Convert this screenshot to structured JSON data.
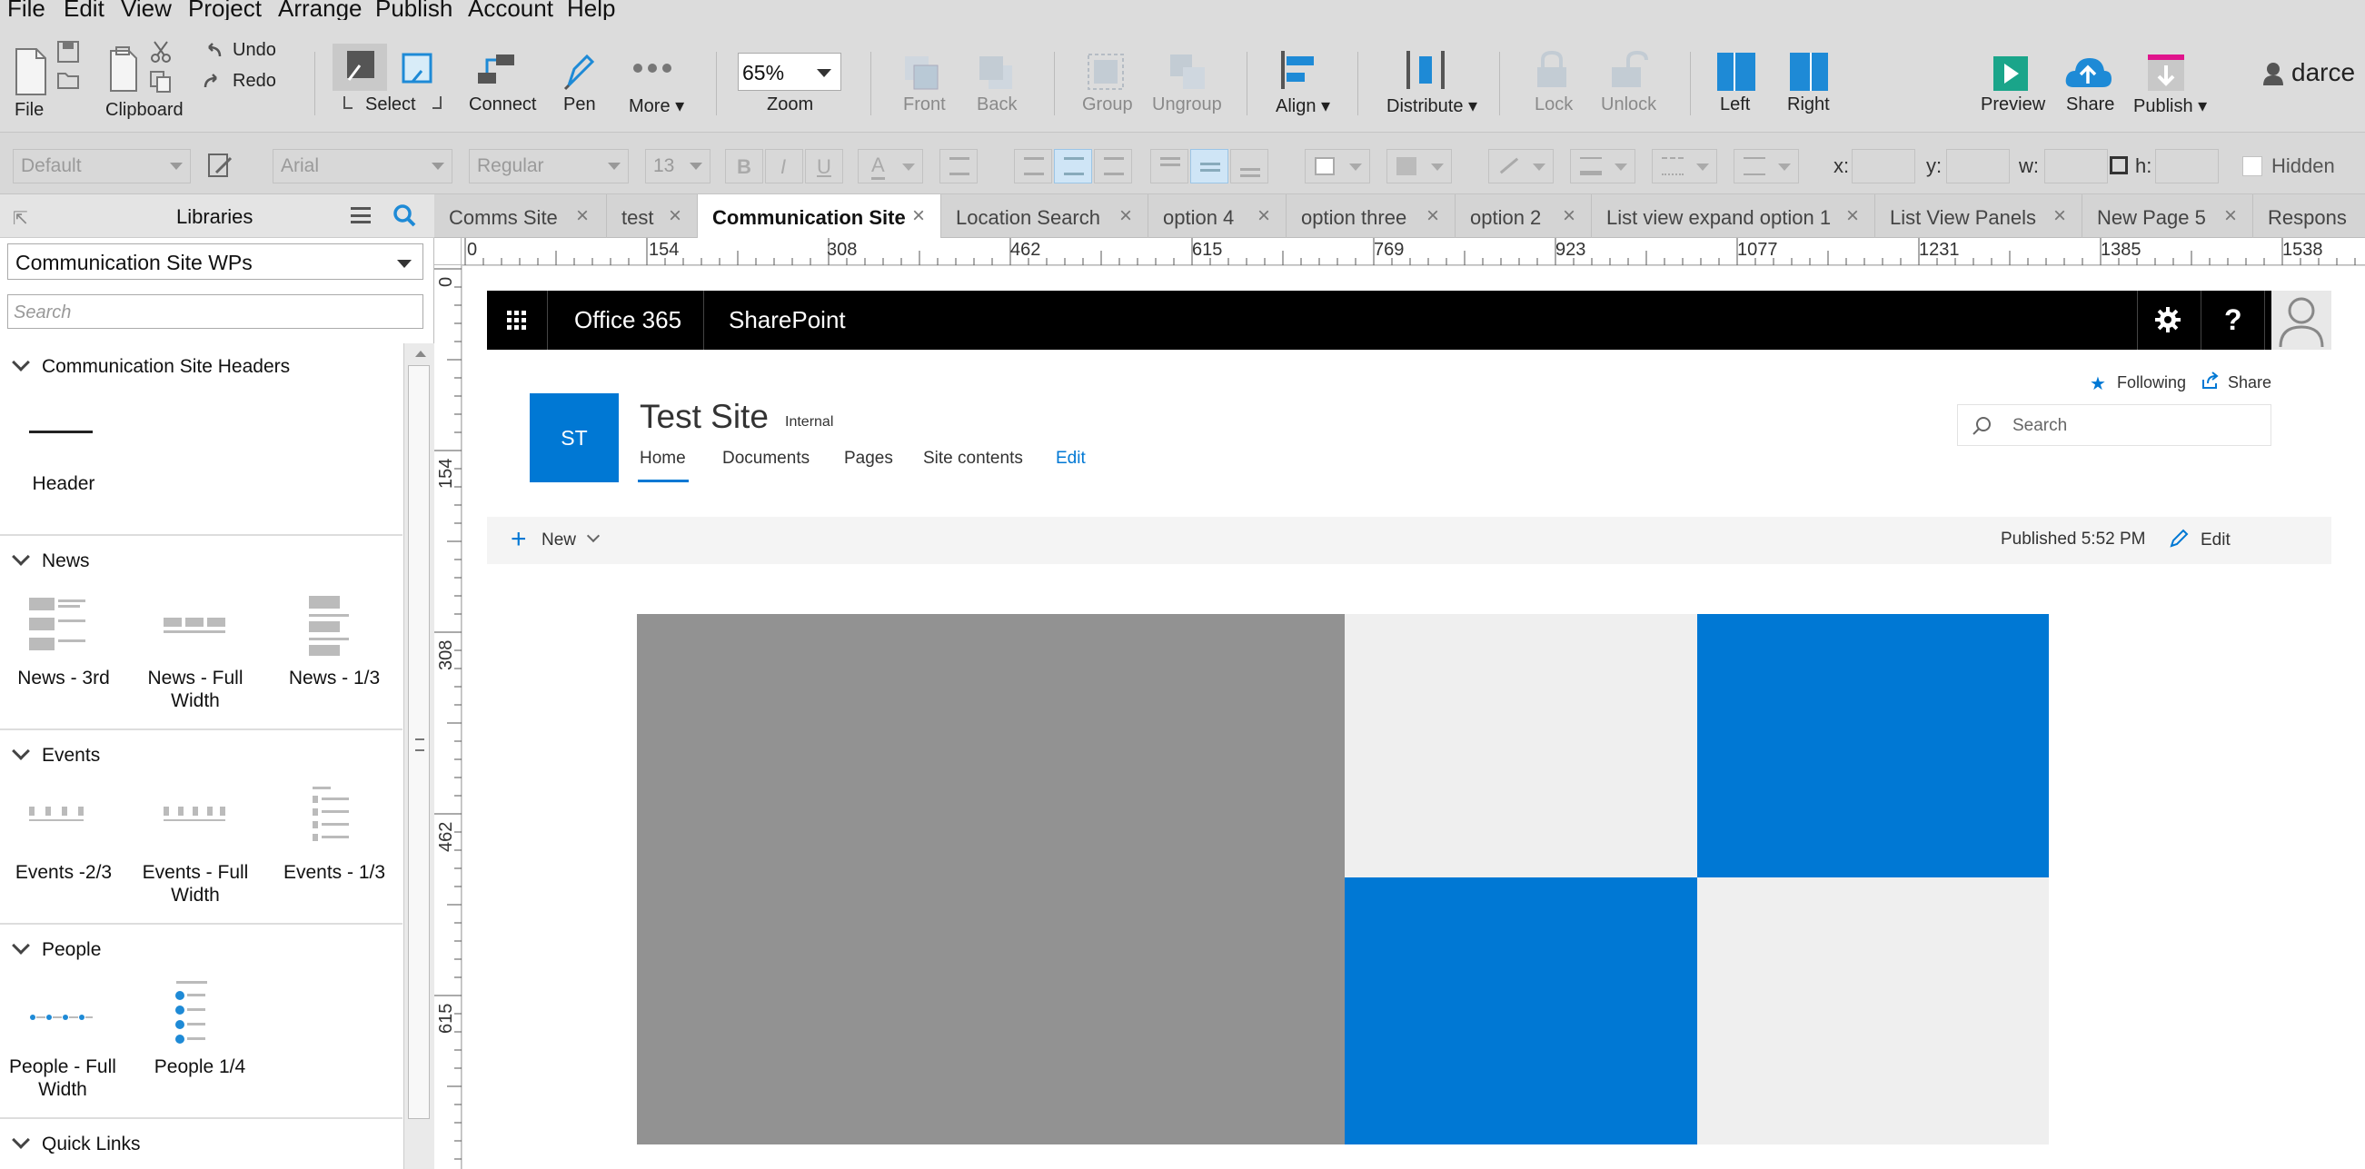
{
  "menu": [
    "File",
    "Edit",
    "View",
    "Project",
    "Arrange",
    "Publish",
    "Account",
    "Help"
  ],
  "toolbar": {
    "file": "File",
    "clipboard": "Clipboard",
    "undo": "Undo",
    "redo": "Redo",
    "select": "Select",
    "connect": "Connect",
    "pen": "Pen",
    "more": "More ▾",
    "zoom_value": "65%",
    "zoom": "Zoom",
    "front": "Front",
    "back": "Back",
    "group": "Group",
    "ungroup": "Ungroup",
    "align": "Align ▾",
    "distribute": "Distribute ▾",
    "lock": "Lock",
    "unlock": "Unlock",
    "left": "Left",
    "right": "Right",
    "preview": "Preview",
    "share": "Share",
    "publish": "Publish ▾",
    "user": "darce"
  },
  "format": {
    "style": "Default",
    "font": "Arial",
    "weight": "Regular",
    "size": "13",
    "x_label": "x:",
    "y_label": "y:",
    "w_label": "w:",
    "h_label": "h:",
    "hidden": "Hidden"
  },
  "libraries": {
    "title": "Libraries",
    "selected": "Communication Site WPs",
    "search_placeholder": "Search",
    "sections": [
      {
        "title": "Communication Site Headers",
        "items": [
          "Header"
        ]
      },
      {
        "title": "News",
        "items": [
          "News - 3rd",
          "News - Full Width",
          "News - 1/3"
        ]
      },
      {
        "title": "Events",
        "items": [
          "Events -2/3",
          "Events - Full Width",
          "Events - 1/3"
        ]
      },
      {
        "title": "People",
        "items": [
          "People - Full Width",
          "People 1/4"
        ]
      },
      {
        "title": "Quick Links",
        "items": []
      }
    ]
  },
  "tabs": [
    "Comms Site",
    "test",
    "Communication Site",
    "Location Search",
    "option 4",
    "option three",
    "option 2",
    "List view expand option 1",
    "List View Panels",
    "New Page 5",
    "Respons"
  ],
  "active_tab": "Communication Site",
  "ruler_h": [
    "0",
    "154",
    "308",
    "462",
    "615",
    "769",
    "923",
    "1077",
    "1231",
    "1385",
    "1538"
  ],
  "ruler_v": [
    "0",
    "154",
    "308",
    "462",
    "615"
  ],
  "sharepoint": {
    "suite_app": "Office 365",
    "suite_product": "SharePoint",
    "site_initials": "ST",
    "site_title": "Test Site",
    "site_class": "Internal",
    "following": "Following",
    "share": "Share",
    "search_placeholder": "Search",
    "nav": [
      "Home",
      "Documents",
      "Pages",
      "Site contents",
      "Edit"
    ],
    "cmd_new": "New",
    "published": "Published 5:52 PM",
    "cmd_edit": "Edit"
  },
  "colors": {
    "accent": "#0078d4",
    "hero_gray": "#929292",
    "hero_light": "#efefef",
    "suite_bar": "#000000",
    "command_bar": "#f4f4f4"
  }
}
